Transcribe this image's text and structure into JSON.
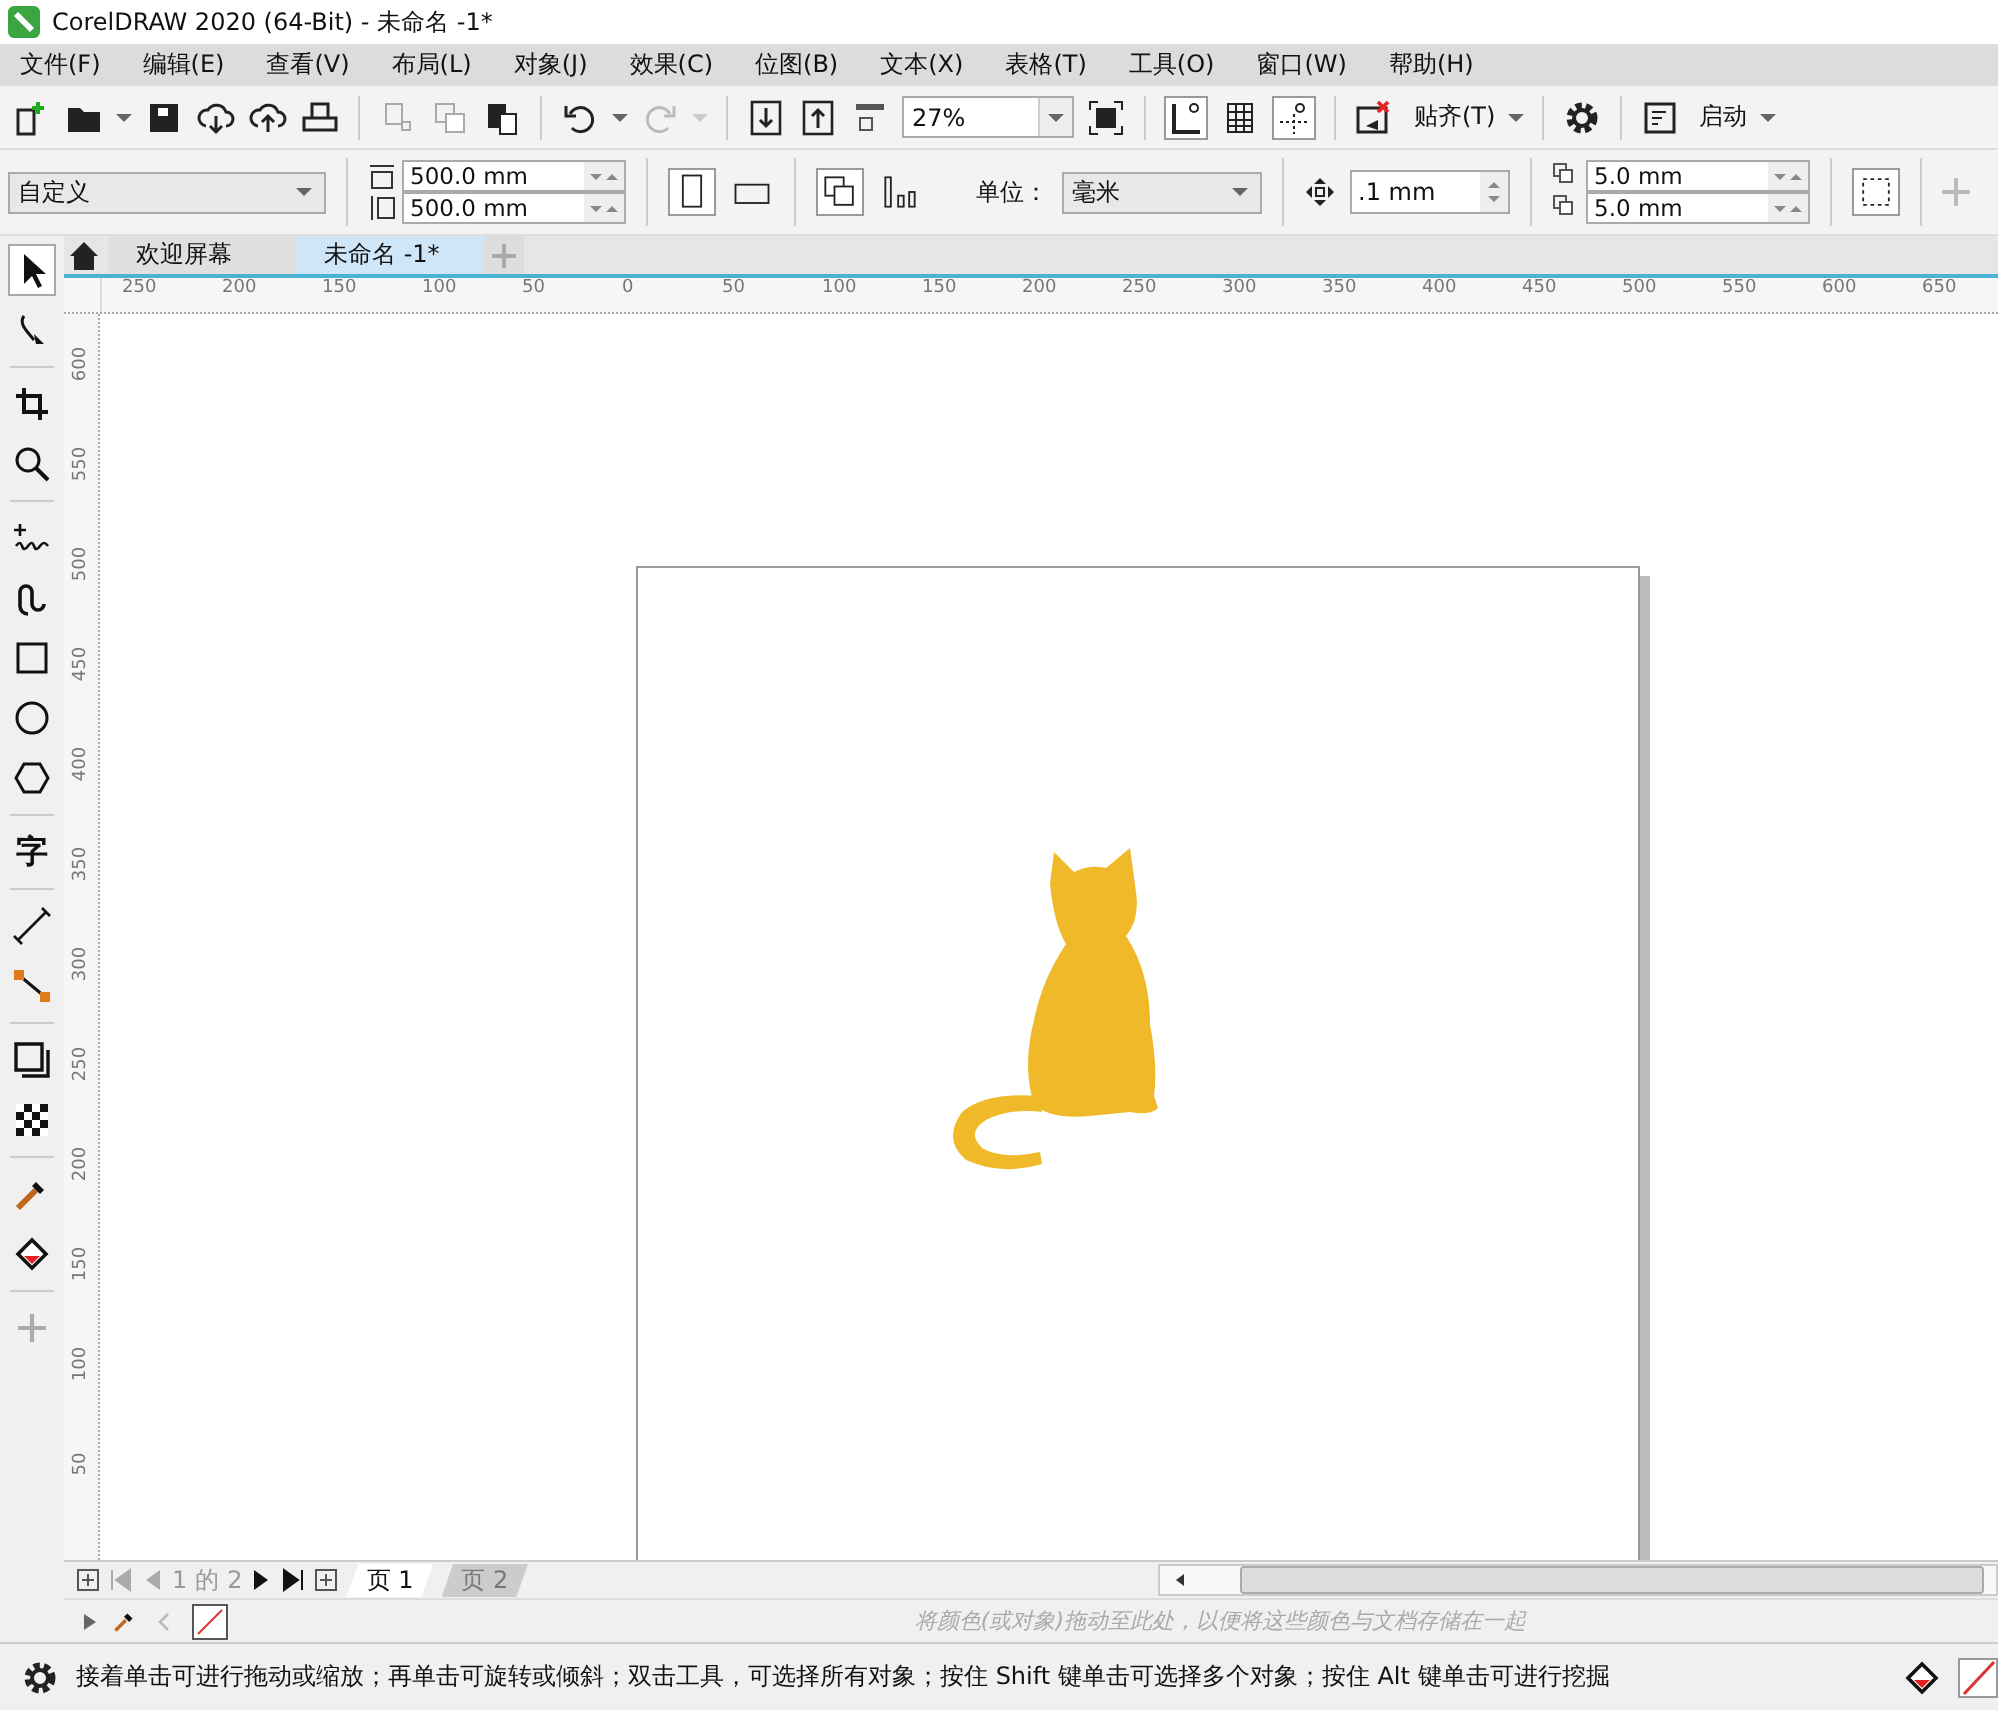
{
  "window": {
    "title": "CorelDRAW 2020 (64-Bit) - 未命名 -1*"
  },
  "menu": [
    "文件(F)",
    "编辑(E)",
    "查看(V)",
    "布局(L)",
    "对象(J)",
    "效果(C)",
    "位图(B)",
    "文本(X)",
    "表格(T)",
    "工具(O)",
    "窗口(W)",
    "帮助(H)"
  ],
  "toolbar": {
    "zoom": "27%",
    "snap": "贴齐(T)",
    "launch": "启动"
  },
  "property_bar": {
    "preset": "自定义",
    "width": "500.0 mm",
    "height": "500.0 mm",
    "units_label": "单位：",
    "units": "毫米",
    "nudge": ".1 mm",
    "dup_x": "5.0 mm",
    "dup_y": "5.0 mm"
  },
  "doc_tabs": [
    {
      "label": "欢迎屏幕",
      "selected": false
    },
    {
      "label": "未命名 -1*",
      "selected": true
    }
  ],
  "tools": [
    {
      "kind": "pick",
      "selected": true
    },
    {
      "kind": "shape",
      "selected": false
    },
    {
      "kind": "crop",
      "selected": false
    },
    {
      "kind": "zoom",
      "selected": false
    },
    {
      "kind": "freehand",
      "selected": false
    },
    {
      "kind": "artistic",
      "selected": false
    },
    {
      "kind": "rect",
      "selected": false
    },
    {
      "kind": "ellipse",
      "selected": false
    },
    {
      "kind": "polygon",
      "selected": false
    },
    {
      "kind": "text",
      "glyph": "字",
      "selected": false
    },
    {
      "kind": "dimension",
      "selected": false
    },
    {
      "kind": "connector",
      "selected": false
    },
    {
      "kind": "shadow",
      "selected": false
    },
    {
      "kind": "transparency",
      "selected": false
    },
    {
      "kind": "eyedropper",
      "selected": false
    },
    {
      "kind": "fill",
      "selected": false
    },
    {
      "kind": "add",
      "selected": false
    }
  ],
  "ruler": {
    "horizontal": [
      "250",
      "200",
      "150",
      "100",
      "50",
      "0",
      "50",
      "100",
      "150",
      "200",
      "250",
      "300",
      "350",
      "400",
      "450",
      "500",
      "550",
      "600",
      "650"
    ],
    "vertical": [
      "600",
      "550",
      "500",
      "450",
      "400",
      "350",
      "300",
      "250",
      "200",
      "150",
      "100",
      "50"
    ]
  },
  "page_nav": {
    "current": "1",
    "of": "的",
    "total": "2"
  },
  "page_tabs": [
    {
      "label": "页 1",
      "selected": true
    },
    {
      "label": "页 2",
      "selected": false
    }
  ],
  "palette_hint": "将颜色(或对象)拖动至此处，以便将这些颜色与文档存储在一起",
  "status": "接着单击可进行拖动或缩放；再单击可旋转或倾斜；双击工具，可选择所有对象；按住 Shift 键单击可选择多个对象；按住 Alt 键单击可进行挖掘"
}
